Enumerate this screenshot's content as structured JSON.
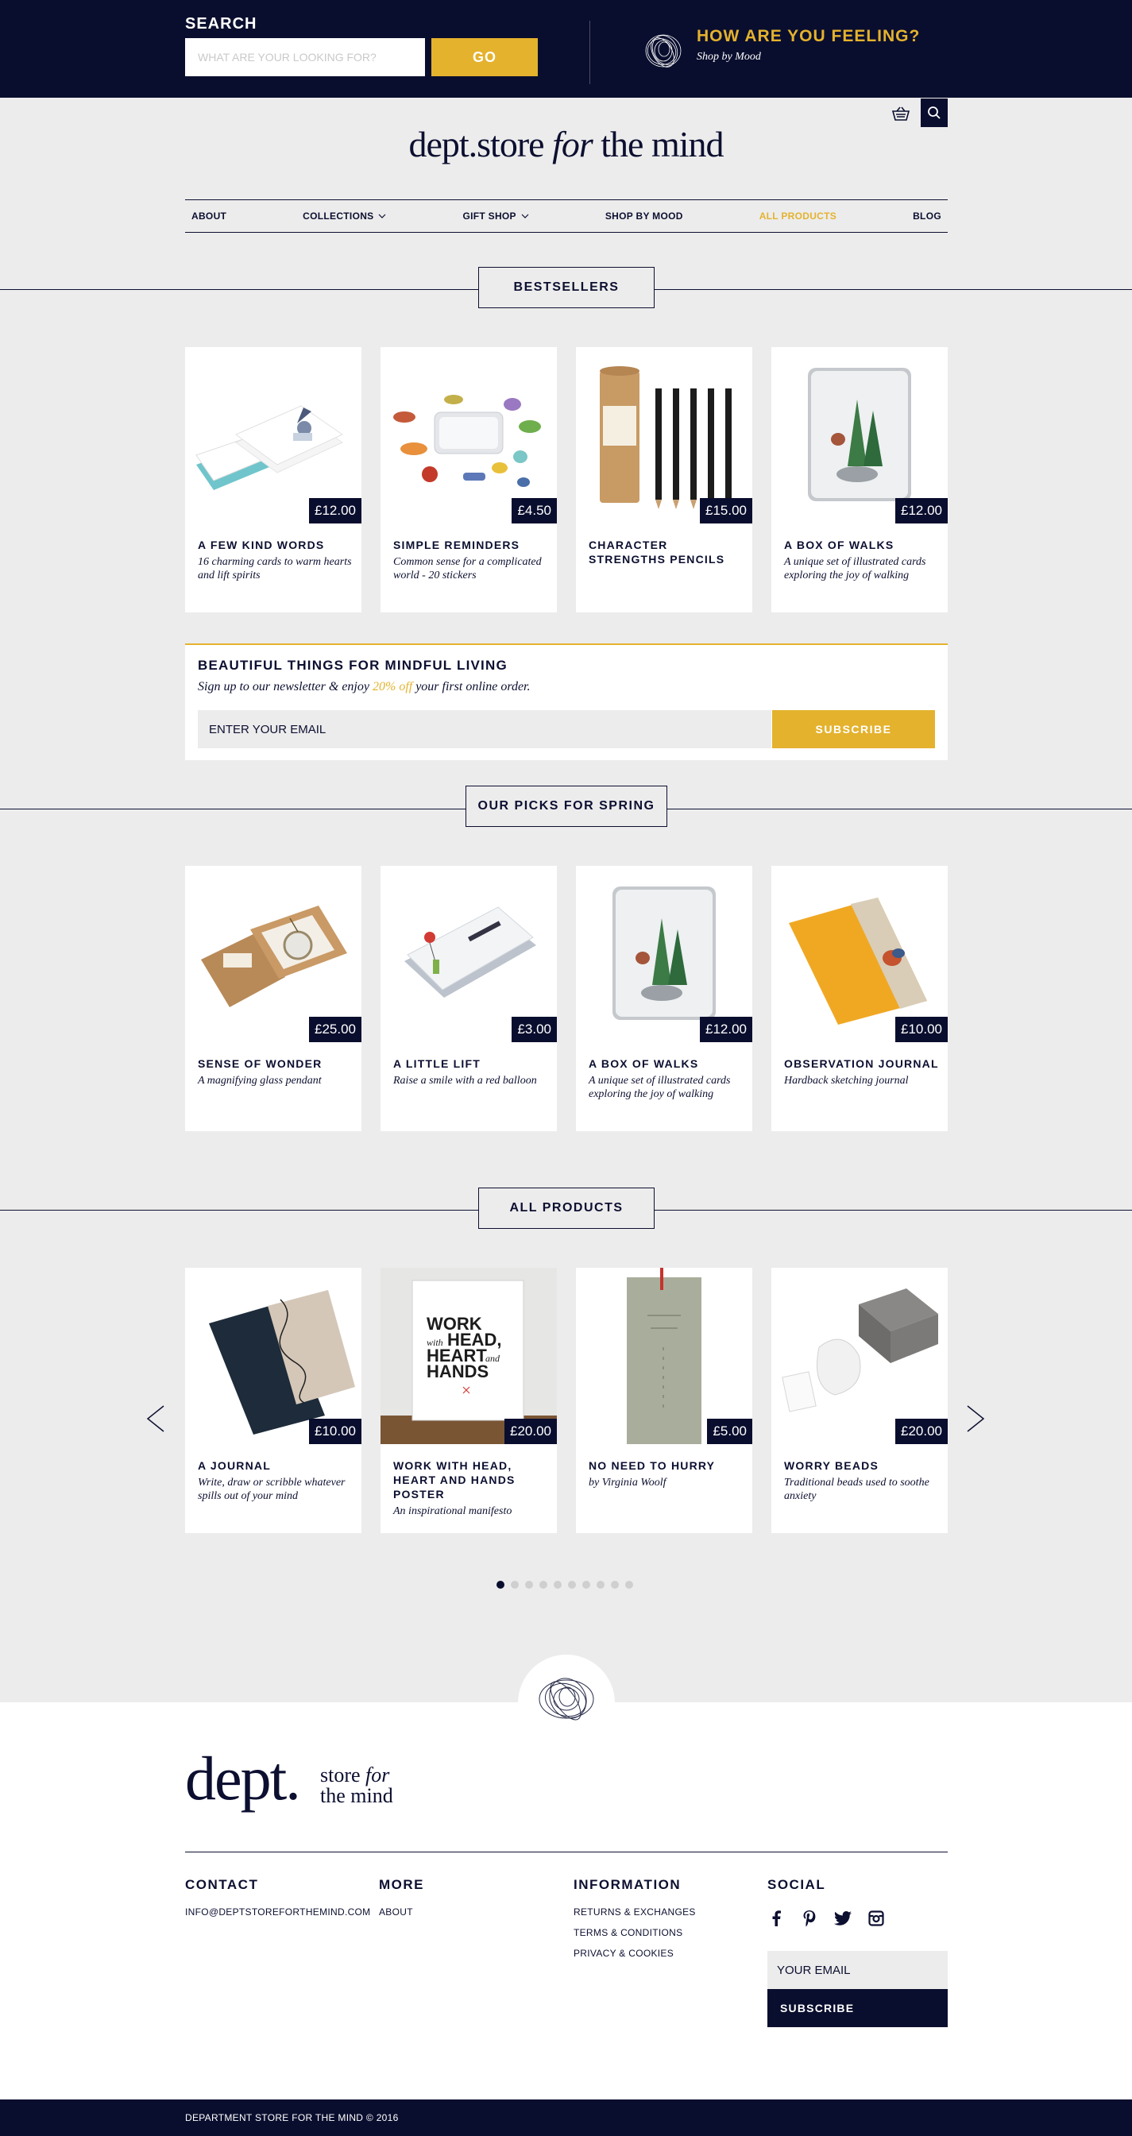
{
  "topbar": {
    "search_label": "SEARCH",
    "search_placeholder": "WHAT ARE YOUR LOOKING FOR?",
    "go_label": "GO",
    "mood_title": "HOW ARE YOU FEELING?",
    "mood_subtitle": "Shop by Mood"
  },
  "header": {
    "logo_main": "dept.store ",
    "logo_italic": "for",
    "logo_end": " the mind"
  },
  "nav": {
    "items": [
      "ABOUT",
      "COLLECTIONS",
      "GIFT SHOP",
      "SHOP BY MOOD",
      "ALL PRODUCTS",
      "BLOG"
    ]
  },
  "sections": {
    "bestsellers": "BESTSELLERS",
    "spring": "OUR PICKS FOR SPRING",
    "all": "ALL PRODUCTS"
  },
  "bestsellers": [
    {
      "title": "A FEW KIND WORDS",
      "desc": "16 charming cards to warm hearts and lift spirits",
      "price": "£12.00",
      "image": "card-boxes"
    },
    {
      "title": "SIMPLE REMINDERS",
      "desc": "Common sense for a complicated world - 20 stickers",
      "price": "£4.50",
      "image": "sticker-tin"
    },
    {
      "title": "CHARACTER STRENGTHS PENCILS",
      "desc": "",
      "price": "£15.00",
      "image": "pencils"
    },
    {
      "title": "A BOX OF WALKS",
      "desc": "A unique set of illustrated cards exploring the joy of walking",
      "price": "£12.00",
      "image": "walks-tin"
    }
  ],
  "newsletter": {
    "title": "BEAUTIFUL THINGS FOR MINDFUL LIVING",
    "sub_before": "Sign up to our newsletter & enjoy ",
    "sub_highlight": "20% off",
    "sub_after": " your first online order.",
    "email_placeholder": "ENTER YOUR EMAIL",
    "button": "SUBSCRIBE"
  },
  "spring": [
    {
      "title": "SENSE OF WONDER",
      "desc": "A magnifying glass pendant",
      "price": "£25.00",
      "image": "pendant-box"
    },
    {
      "title": "A LITTLE LIFT",
      "desc": "Raise a smile with a red balloon",
      "price": "£3.00",
      "image": "lift-tin"
    },
    {
      "title": "A BOX OF WALKS",
      "desc": "A unique set of illustrated cards exploring the joy of walking",
      "price": "£12.00",
      "image": "walks-tin"
    },
    {
      "title": "OBSERVATION JOURNAL",
      "desc": "Hardback sketching journal",
      "price": "£10.00",
      "image": "yellow-journal"
    }
  ],
  "all_products": [
    {
      "title": "A JOURNAL",
      "desc": "Write, draw or scribble whatever spills out of your mind",
      "price": "£10.00",
      "image": "navy-journal"
    },
    {
      "title": "WORK WITH HEAD, HEART AND HANDS POSTER",
      "desc": "An inspirational manifesto",
      "price": "£20.00",
      "image": "poster"
    },
    {
      "title": "NO NEED TO HURRY",
      "desc": "by Virginia Woolf",
      "price": "£5.00",
      "image": "bookmark"
    },
    {
      "title": "WORRY BEADS",
      "desc": "Traditional beads used to soothe anxiety",
      "price": "£20.00",
      "image": "worry-beads"
    }
  ],
  "poster_text": {
    "l1": "WORK",
    "l2a": "with",
    "l2b": "HEAD,",
    "l3a": "HEART",
    "l3b": "and",
    "l4": "HANDS"
  },
  "carousel": {
    "dot_count": 10,
    "active_index": 0
  },
  "footer": {
    "logo_dept": "dept.",
    "logo_store": "store ",
    "logo_for": "for",
    "logo_mind": "the mind",
    "contact": {
      "heading": "CONTACT",
      "email": "INFO@DEPTSTOREFORTHEMIND.COM"
    },
    "more": {
      "heading": "MORE",
      "links": [
        "ABOUT"
      ]
    },
    "information": {
      "heading": "INFORMATION",
      "links": [
        "RETURNS & EXCHANGES",
        "TERMS & CONDITIONS",
        "PRIVACY & COOKIES"
      ]
    },
    "social": {
      "heading": "SOCIAL",
      "icons": [
        "facebook-icon",
        "pinterest-icon",
        "twitter-icon",
        "instagram-icon"
      ]
    },
    "email_placeholder": "YOUR EMAIL",
    "subscribe": "SUBSCRIBE",
    "copyright": "DEPARTMENT STORE FOR THE MIND © 2016"
  },
  "colors": {
    "navy": "#0a0e2e",
    "gold": "#e4b22d",
    "bg": "#ececec"
  }
}
